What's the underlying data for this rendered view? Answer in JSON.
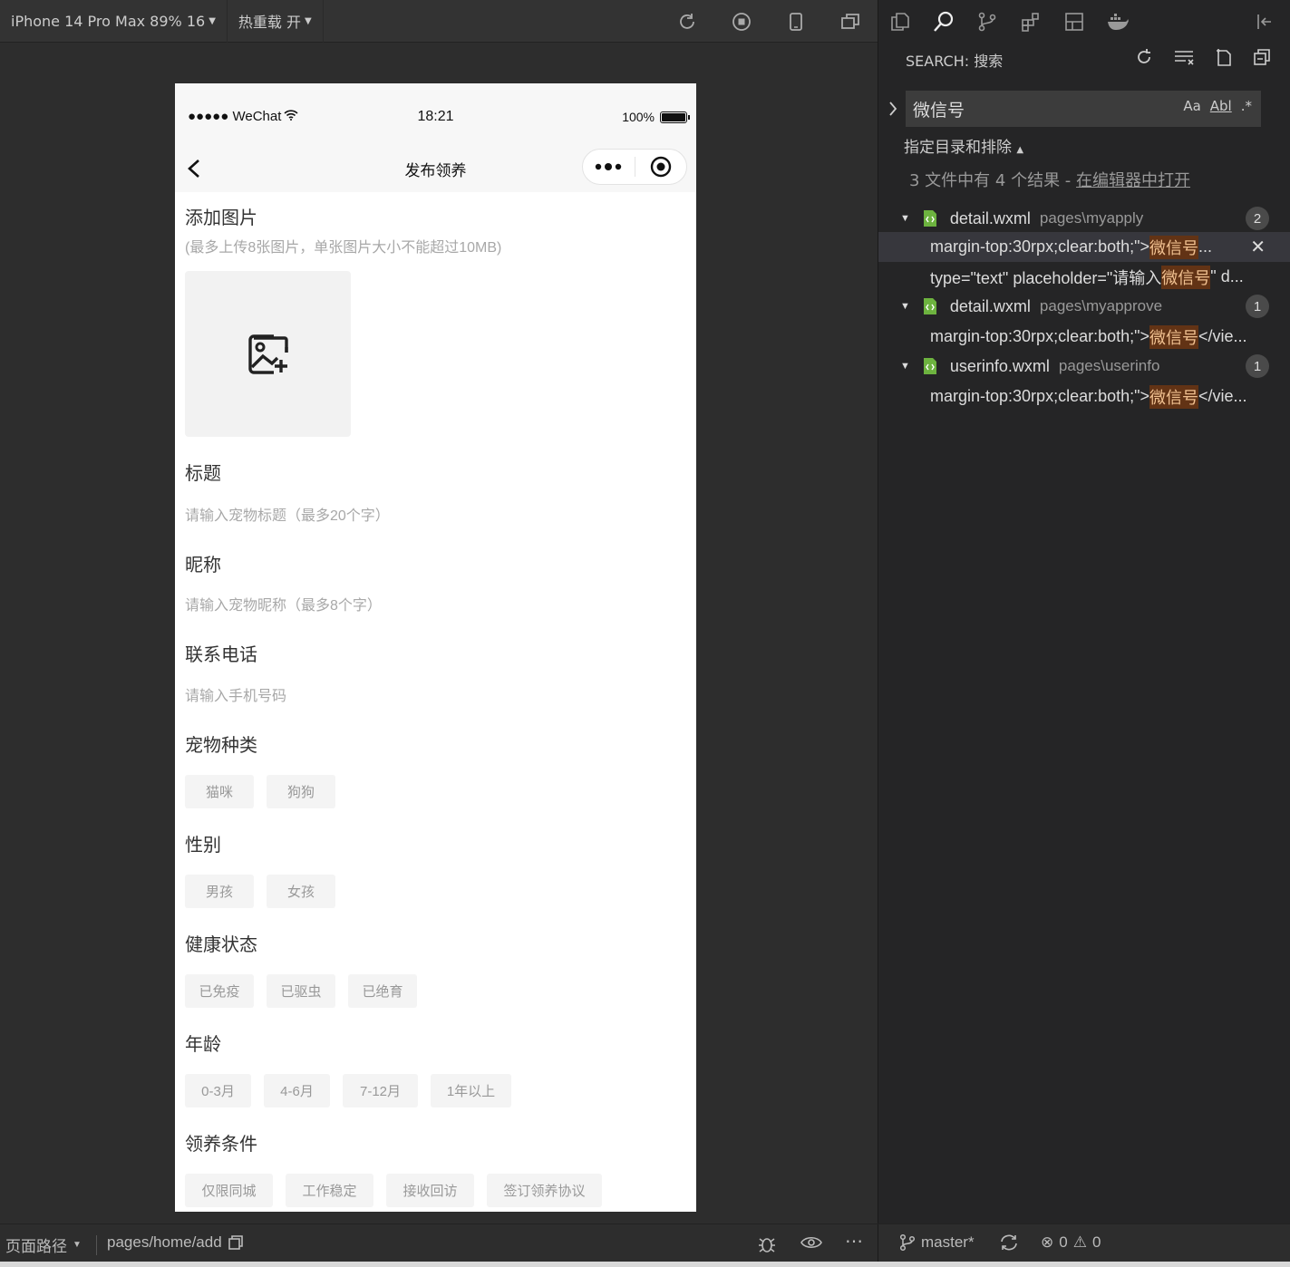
{
  "topbar": {
    "device": "iPhone 14 Pro Max 89% 16",
    "hot_reload": "热重载 开"
  },
  "phone": {
    "status": {
      "carrier": "●●●●● WeChat",
      "time": "18:21",
      "battery": "100%"
    },
    "nav_title": "发布领养",
    "add_image": {
      "label": "添加图片",
      "hint": "(最多上传8张图片，单张图片大小不能超过10MB)"
    },
    "title_field": {
      "label": "标题",
      "placeholder": "请输入宠物标题（最多20个字）"
    },
    "nickname_field": {
      "label": "昵称",
      "placeholder": "请输入宠物昵称（最多8个字）"
    },
    "phone_field": {
      "label": "联系电话",
      "placeholder": "请输入手机号码"
    },
    "species": {
      "label": "宠物种类",
      "options": [
        "猫咪",
        "狗狗"
      ]
    },
    "gender": {
      "label": "性别",
      "options": [
        "男孩",
        "女孩"
      ]
    },
    "health": {
      "label": "健康状态",
      "options": [
        "已免疫",
        "已驱虫",
        "已绝育"
      ]
    },
    "age": {
      "label": "年龄",
      "options": [
        "0-3月",
        "4-6月",
        "7-12月",
        "1年以上"
      ]
    },
    "conditions": {
      "label": "领养条件",
      "options": [
        "仅限同城",
        "工作稳定",
        "接收回访",
        "签订领养协议"
      ]
    }
  },
  "search": {
    "header": "SEARCH: 搜索",
    "query": "微信号",
    "opt_case": "Aa",
    "opt_word": "Abl",
    "opt_regex": ".*",
    "include_exclude": "指定目录和排除",
    "summary_prefix": "3 文件中有 4 个结果 - ",
    "summary_link": "在编辑器中打开",
    "files": [
      {
        "name": "detail.wxml",
        "path": "pages\\myapply",
        "count": "2",
        "matches": [
          {
            "before": "margin-top:30rpx;clear:both;\">",
            "hit": "微信号",
            "after": "..."
          },
          {
            "before": "type=\"text\" placeholder=\"请输入",
            "hit": "微信号",
            "after": "\" d..."
          }
        ]
      },
      {
        "name": "detail.wxml",
        "path": "pages\\myapprove",
        "count": "1",
        "matches": [
          {
            "before": "margin-top:30rpx;clear:both;\">",
            "hit": "微信号",
            "after": "</vie..."
          }
        ]
      },
      {
        "name": "userinfo.wxml",
        "path": "pages\\userinfo",
        "count": "1",
        "matches": [
          {
            "before": "margin-top:30rpx;clear:both;\">",
            "hit": "微信号",
            "after": "</vie..."
          }
        ]
      }
    ]
  },
  "bottombar": {
    "page_path_label": "页面路径",
    "page_path": "pages/home/add",
    "branch": "master*",
    "errors": "0",
    "warnings": "0"
  }
}
